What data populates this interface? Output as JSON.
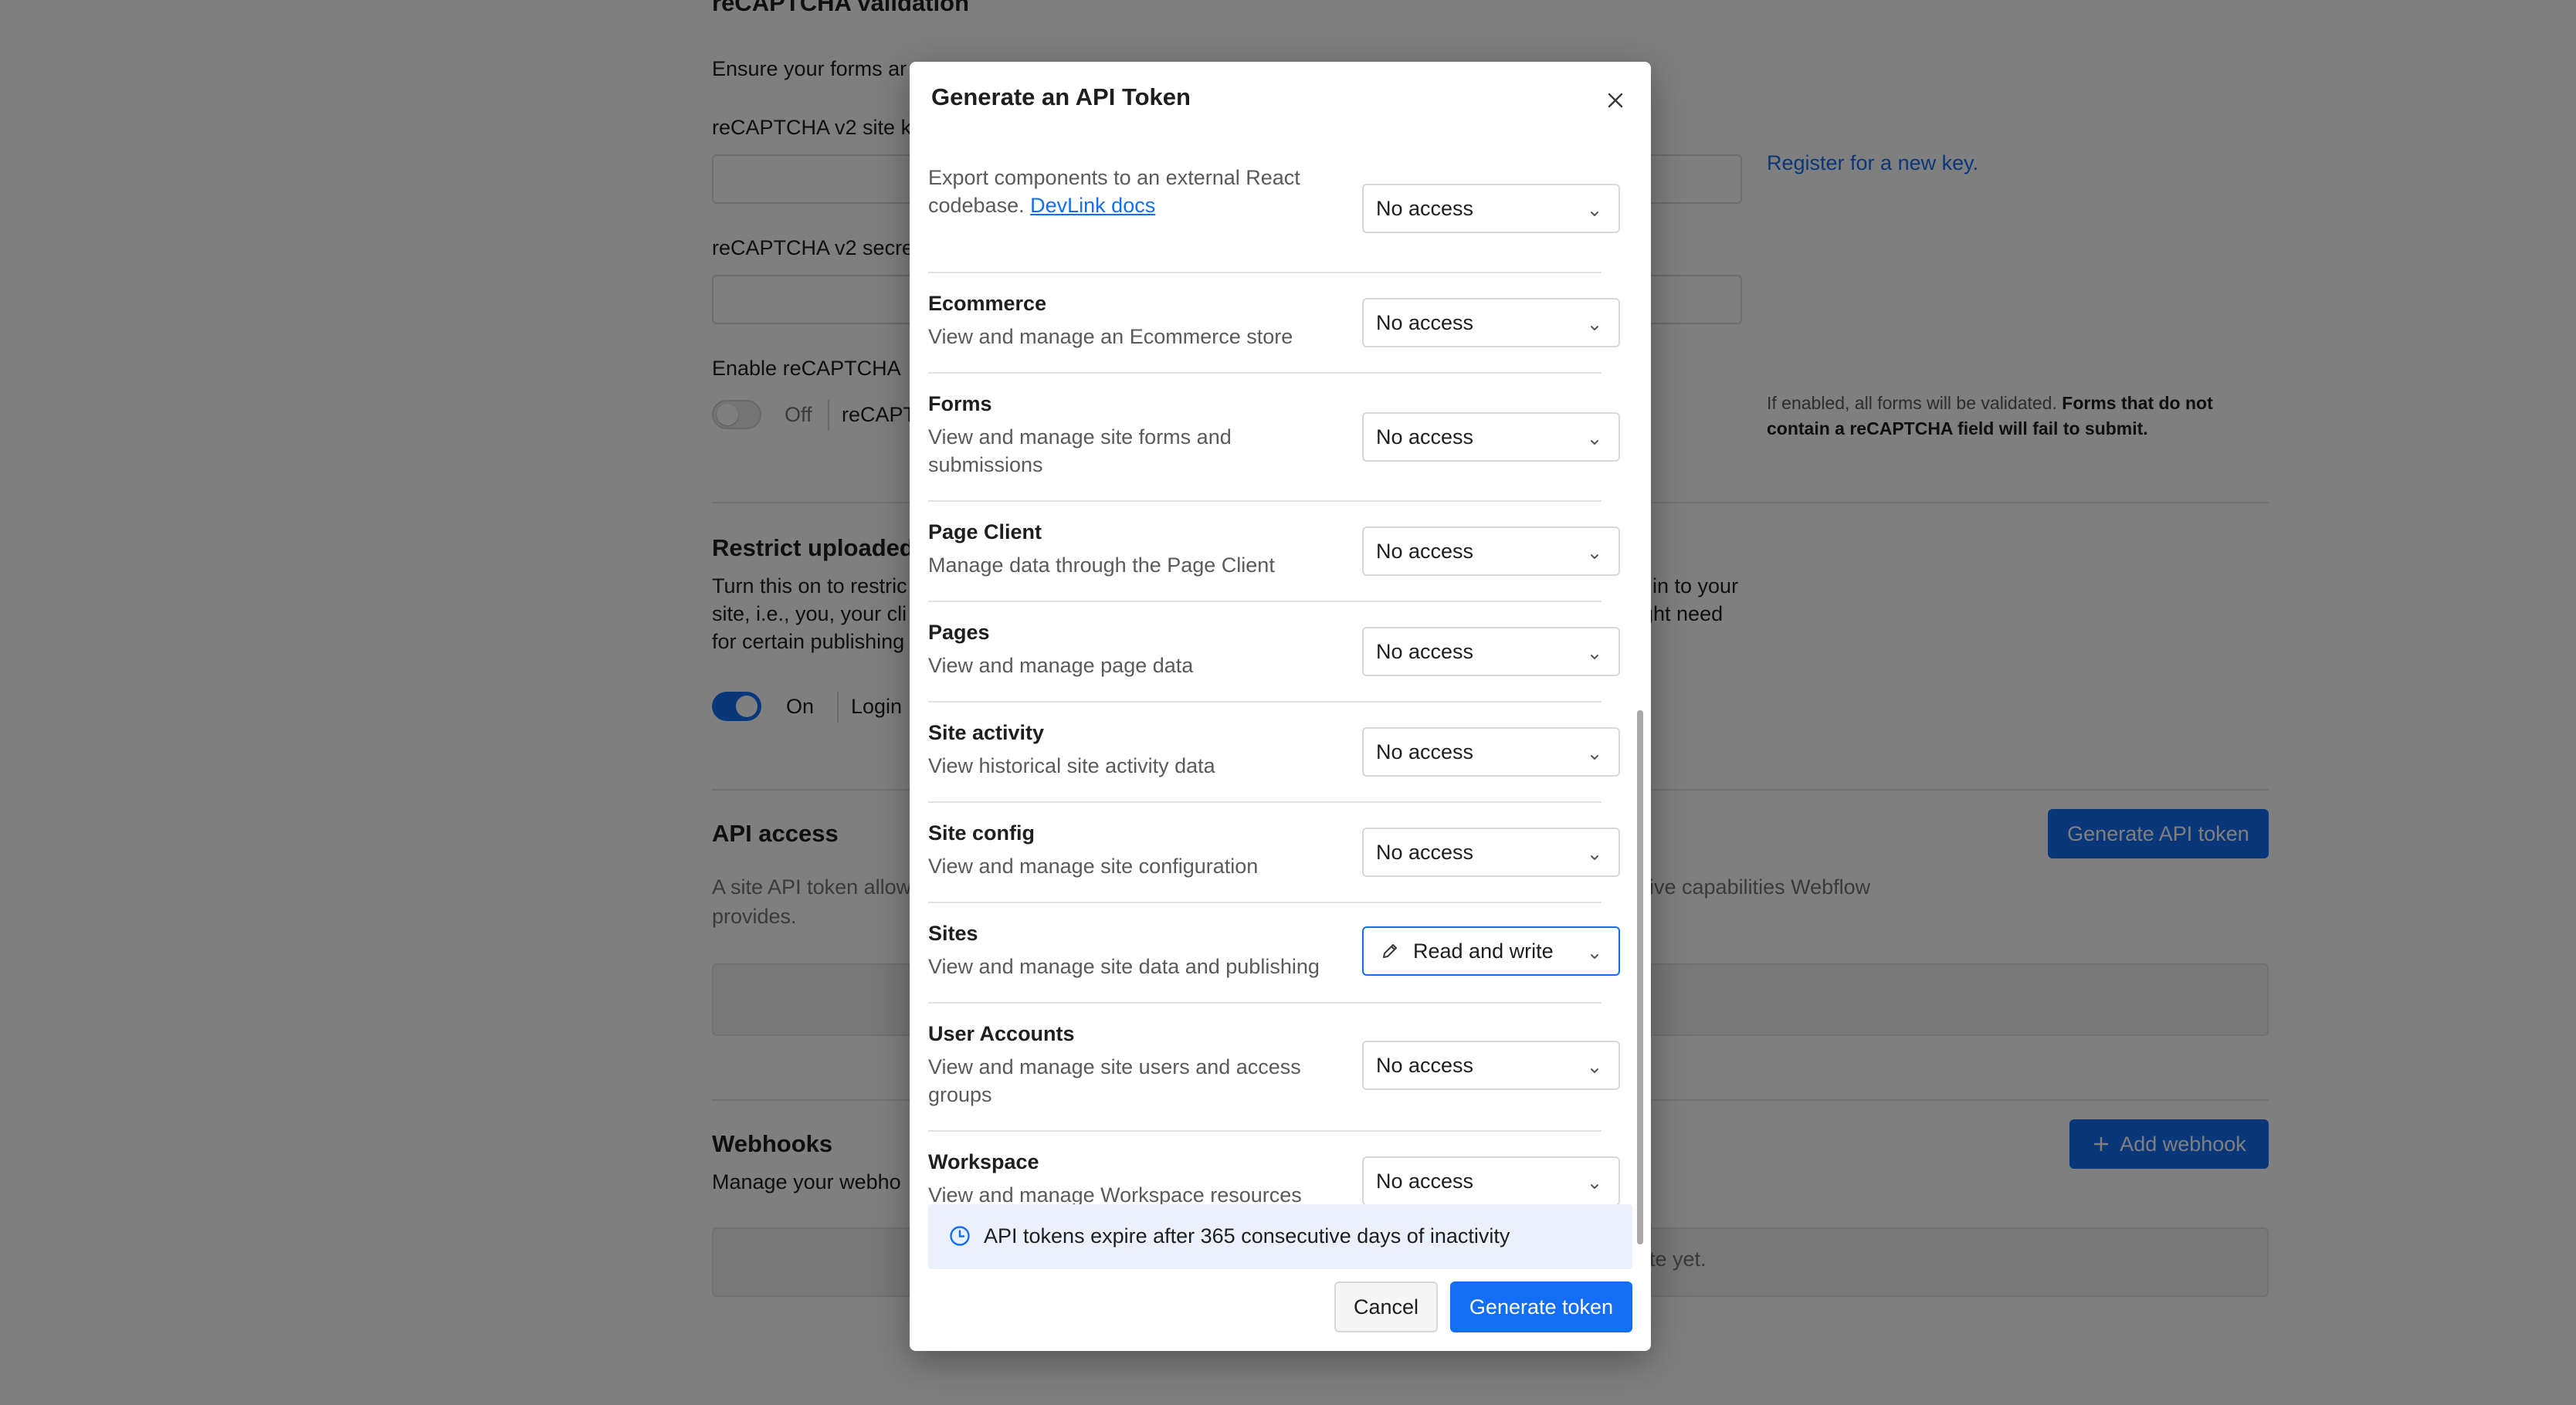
{
  "background": {
    "recaptcha_heading": "reCAPTCHA validation",
    "recaptcha_intro": "Ensure your forms ar",
    "site_key_label": "reCAPTCHA v2 site k",
    "register_link": "Register for a new key.",
    "secret_label": "reCAPTCHA v2 secre",
    "enable_label": "Enable reCAPTCHA",
    "enable_toggle_state": "Off",
    "enable_toggle_suffix": "reCAPT",
    "enable_note_plain": "If enabled, all forms will be validated.",
    "enable_note_bold": "Forms that do not contain a reCAPTCHA field will fail to submit.",
    "restrict_heading": "Restrict uploaded",
    "restrict_text_line1_left": "Turn this on to restric",
    "restrict_text_line1_right": "in to your",
    "restrict_text_line2_left": "site, i.e., you, your cli",
    "restrict_text_line2_right": "ght need",
    "restrict_text_line3_left": "for certain publishing",
    "restrict_toggle_state": "On",
    "restrict_toggle_suffix": "Login",
    "api_heading": "API access",
    "api_text_left": "A site API token allow",
    "api_text_right": "ive capabilities Webflow",
    "api_text_line2": "provides.",
    "api_button": "Generate API token",
    "webhooks_heading": "Webhooks",
    "webhooks_text": "Manage your webho",
    "webhooks_button": "Add webhook",
    "webhooks_empty_tail": "ite yet."
  },
  "modal": {
    "title": "Generate an API Token",
    "permissions": [
      {
        "title": "",
        "description": "Export components to an external React codebase.",
        "link": "DevLink docs",
        "access": "No access"
      },
      {
        "title": "Ecommerce",
        "description": "View and manage an Ecommerce store",
        "access": "No access"
      },
      {
        "title": "Forms",
        "description": "View and manage site forms and submissions",
        "access": "No access"
      },
      {
        "title": "Page Client",
        "description": "Manage data through the Page Client",
        "access": "No access"
      },
      {
        "title": "Pages",
        "description": "View and manage page data",
        "access": "No access"
      },
      {
        "title": "Site activity",
        "description": "View historical site activity data",
        "access": "No access"
      },
      {
        "title": "Site config",
        "description": "View and manage site configuration",
        "access": "No access"
      },
      {
        "title": "Sites",
        "description": "View and manage site data and publishing",
        "access": "Read and write"
      },
      {
        "title": "User Accounts",
        "description": "View and manage site users and access groups",
        "access": "No access"
      },
      {
        "title": "Workspace",
        "description": "View and manage Workspace resources",
        "access": "No access"
      }
    ],
    "info_banner": "API tokens expire after 365 consecutive days of inactivity",
    "cancel_label": "Cancel",
    "generate_label": "Generate token"
  },
  "colors": {
    "accent": "#146ef5",
    "overlay": "rgba(0,0,0,0.5)",
    "info_bg": "#eaf1fd"
  }
}
